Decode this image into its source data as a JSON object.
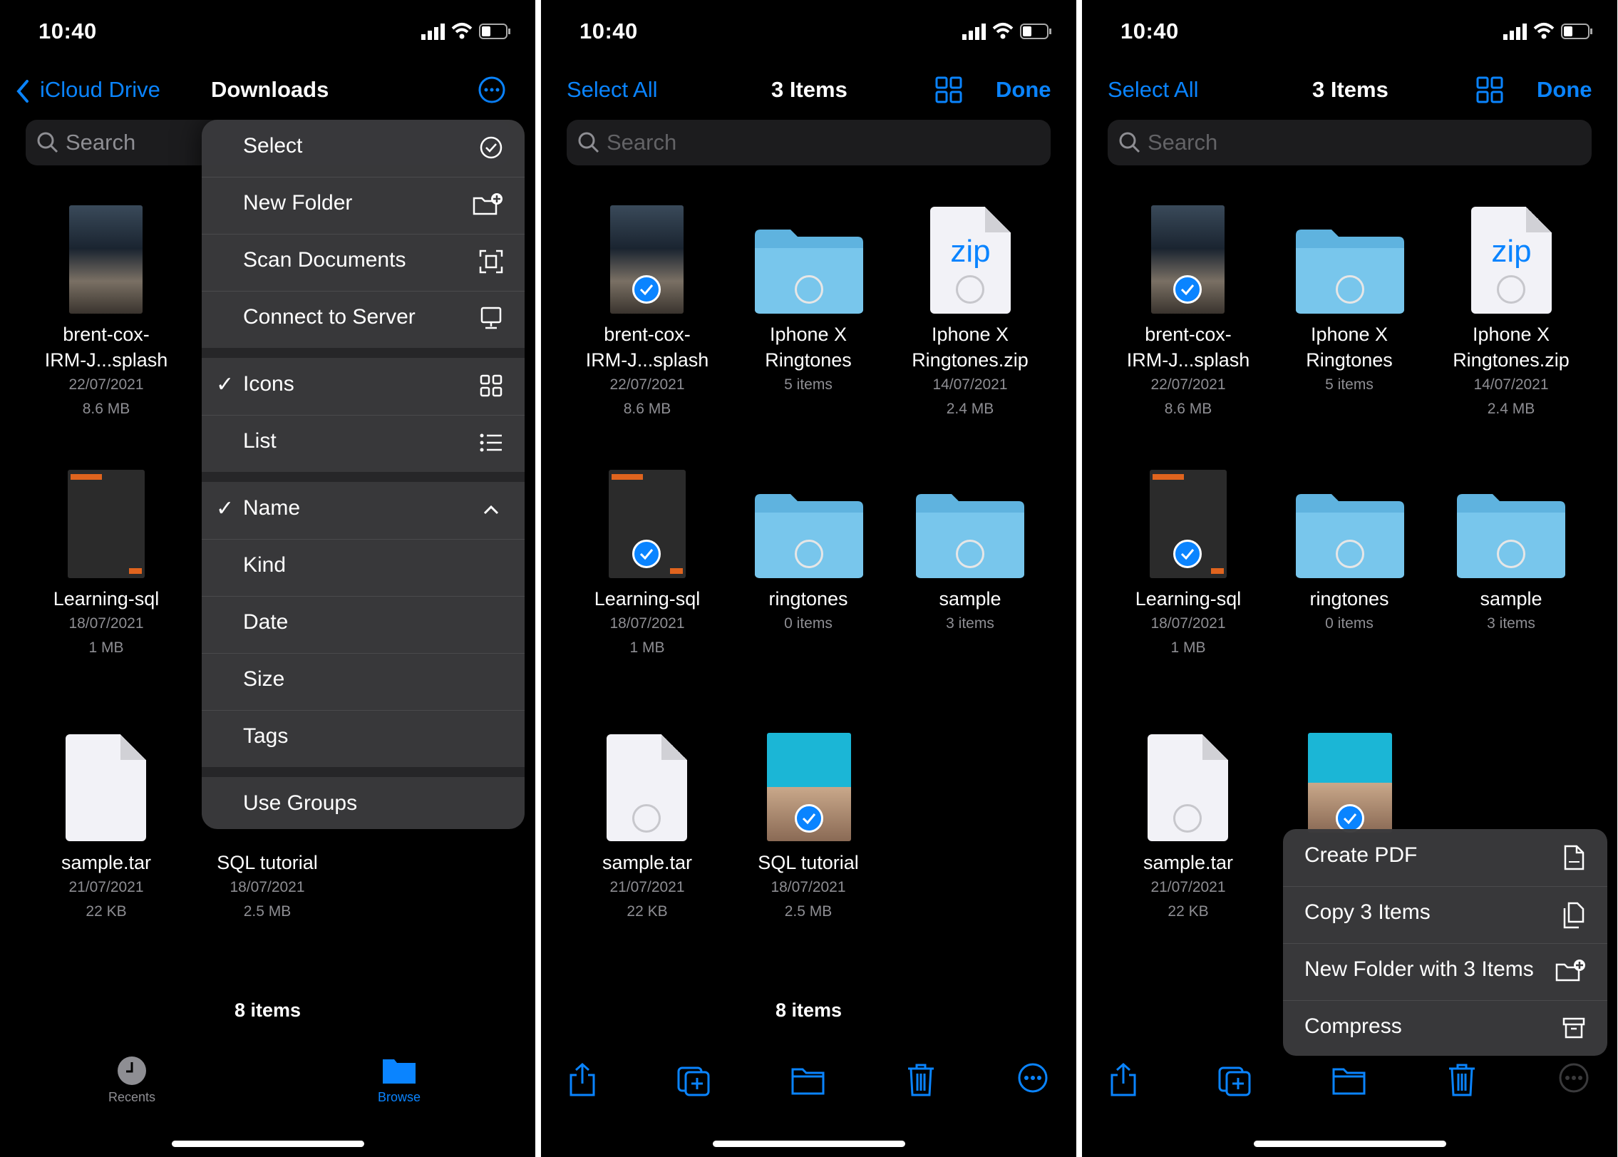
{
  "status": {
    "time": "10:40"
  },
  "panel1": {
    "back_label": "iCloud Drive",
    "title": "Downloads",
    "search_placeholder": "Search",
    "menu": {
      "select": "Select",
      "new_folder": "New Folder",
      "scan_documents": "Scan Documents",
      "connect_to_server": "Connect to Server",
      "icons": "Icons",
      "list": "List",
      "name": "Name",
      "kind": "Kind",
      "date": "Date",
      "size": "Size",
      "tags": "Tags",
      "use_groups": "Use Groups",
      "checkmark": "✓"
    },
    "files": [
      {
        "name1": "brent-cox-",
        "name2": "IRM-J...splash",
        "date": "22/07/2021",
        "size": "8.6 MB"
      },
      {
        "name1": "Learning-sql",
        "date": "18/07/2021",
        "size": "1 MB"
      },
      {
        "name1": "sample.tar",
        "date": "21/07/2021",
        "size": "22 KB"
      },
      {
        "name1": "SQL tutorial",
        "date": "18/07/2021",
        "size": "2.5 MB"
      }
    ],
    "count": "8 items",
    "tabs": {
      "recents": "Recents",
      "browse": "Browse"
    }
  },
  "panel2": {
    "select_all": "Select All",
    "title": "3 Items",
    "done": "Done",
    "search_placeholder": "Search",
    "files": [
      {
        "name1": "brent-cox-",
        "name2": "IRM-J...splash",
        "date": "22/07/2021",
        "size": "8.6 MB"
      },
      {
        "name1": "Iphone X",
        "name2": "Ringtones",
        "meta": "5 items"
      },
      {
        "name1": "Iphone X",
        "name2": "Ringtones.zip",
        "date": "14/07/2021",
        "size": "2.4 MB",
        "zip": "zip"
      },
      {
        "name1": "Learning-sql",
        "date": "18/07/2021",
        "size": "1 MB"
      },
      {
        "name1": "ringtones",
        "meta": "0 items"
      },
      {
        "name1": "sample",
        "meta": "3 items"
      },
      {
        "name1": "sample.tar",
        "date": "21/07/2021",
        "size": "22 KB"
      },
      {
        "name1": "SQL tutorial",
        "date": "18/07/2021",
        "size": "2.5 MB"
      }
    ],
    "count": "8 items"
  },
  "panel3": {
    "select_all": "Select All",
    "title": "3 Items",
    "done": "Done",
    "search_placeholder": "Search",
    "files": [
      {
        "name1": "brent-cox-",
        "name2": "IRM-J...splash",
        "date": "22/07/2021",
        "size": "8.6 MB"
      },
      {
        "name1": "Iphone X",
        "name2": "Ringtones",
        "meta": "5 items"
      },
      {
        "name1": "Iphone X",
        "name2": "Ringtones.zip",
        "date": "14/07/2021",
        "size": "2.4 MB",
        "zip": "zip"
      },
      {
        "name1": "Learning-sql",
        "date": "18/07/2021",
        "size": "1 MB"
      },
      {
        "name1": "ringtones",
        "meta": "0 items"
      },
      {
        "name1": "sample",
        "meta": "3 items"
      },
      {
        "name1": "sample.tar",
        "date": "21/07/2021",
        "size": "22 KB"
      }
    ],
    "context_menu": {
      "create_pdf": "Create PDF",
      "copy_items": "Copy 3 Items",
      "new_folder_with": "New Folder with 3 Items",
      "compress": "Compress"
    }
  },
  "colors": {
    "accent": "#0a84ff",
    "folder": "#6fc0e8",
    "background": "#000000"
  }
}
